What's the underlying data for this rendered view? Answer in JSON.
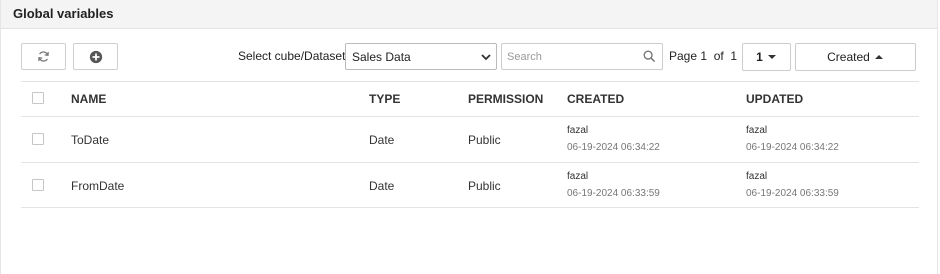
{
  "panel": {
    "title": "Global variables"
  },
  "toolbar": {
    "refresh_icon": "refresh-icon",
    "add_icon": "plus-circle-icon",
    "dataset_label": "Select cube/Dataset",
    "dataset_selected": "Sales Data",
    "search_placeholder": "Search",
    "page_prefix": "Page",
    "page_current": "1",
    "page_of": "of",
    "page_total": "1",
    "page_select_value": "1",
    "sort_label": "Created"
  },
  "table": {
    "columns": [
      "NAME",
      "TYPE",
      "PERMISSION",
      "CREATED",
      "UPDATED"
    ],
    "rows": [
      {
        "name": "ToDate",
        "type": "Date",
        "permission": "Public",
        "created_by": "fazal",
        "created_at": "06-19-2024 06:34:22",
        "updated_by": "fazal",
        "updated_at": "06-19-2024 06:34:22"
      },
      {
        "name": "FromDate",
        "type": "Date",
        "permission": "Public",
        "created_by": "fazal",
        "created_at": "06-19-2024 06:33:59",
        "updated_by": "fazal",
        "updated_at": "06-19-2024 06:33:59"
      }
    ]
  },
  "colors": {
    "border": "#cfcfcf",
    "header_bg": "#f4f4f4",
    "muted": "#777777"
  }
}
